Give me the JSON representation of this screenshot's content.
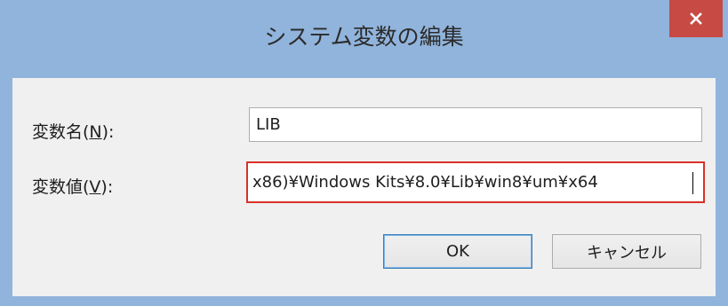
{
  "dialog": {
    "title": "システム変数の編集",
    "close_glyph": "×"
  },
  "form": {
    "name_label_prefix": "変数名(",
    "name_label_mnemonic": "N",
    "name_label_suffix": "):",
    "name_value": "LIB",
    "value_label_prefix": "変数値(",
    "value_label_mnemonic": "V",
    "value_label_suffix": "):",
    "value_visible": "x86)¥Windows Kits¥8.0¥Lib¥win8¥um¥x64"
  },
  "buttons": {
    "ok_label": "OK",
    "cancel_label": "キャンセル"
  },
  "colors": {
    "frame": "#91b4dc",
    "close": "#c74a45",
    "focus_border": "#d9302a"
  }
}
